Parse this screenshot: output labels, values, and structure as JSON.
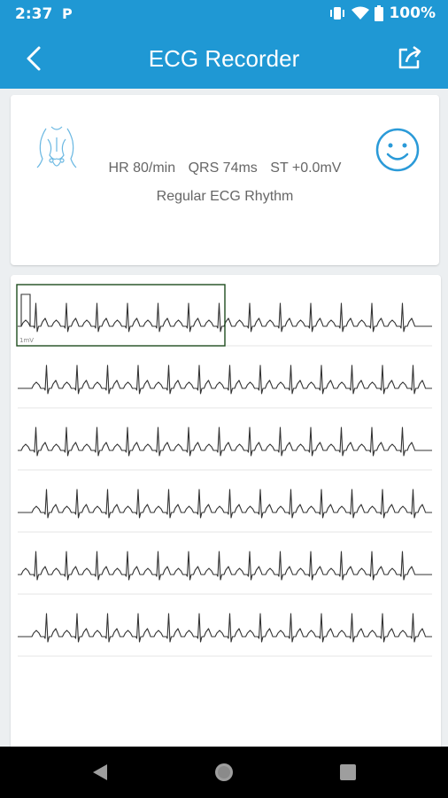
{
  "status_bar": {
    "time": "2:37",
    "notification_icon": "parking-p-icon",
    "icons": [
      "vibrate-icon",
      "wifi-icon",
      "battery-icon"
    ],
    "battery_percent": "100%"
  },
  "app_bar": {
    "title": "ECG Recorder",
    "back_icon": "chevron-left-icon",
    "share_icon": "share-icon",
    "color": "#1f98d4"
  },
  "summary": {
    "body_icon": "torso-icon",
    "heart_rate": "HR 80/min",
    "qrs": "QRS 74ms",
    "st": "ST +0.0mV",
    "rhythm": "Regular ECG Rhythm",
    "status_icon": "smiley-face-icon",
    "accent_color": "#2a9ad8"
  },
  "ecg": {
    "strips": 6,
    "calibration_label": "1mV",
    "highlight_color": "#1e4d1e",
    "trace_color": "#333333"
  },
  "nav_bar": {
    "buttons": [
      "back-triangle-icon",
      "home-circle-icon",
      "recents-square-icon"
    ]
  }
}
